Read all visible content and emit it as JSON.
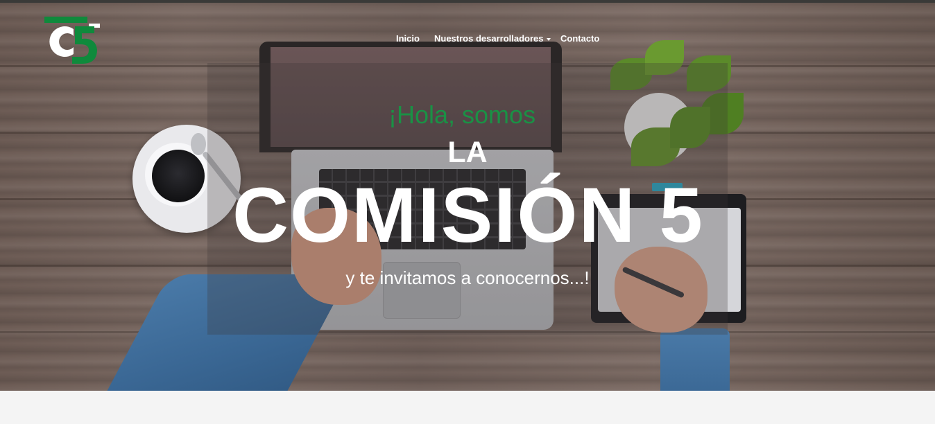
{
  "brand": {
    "logo_text": "C5",
    "primary_color": "#0f8a3c",
    "logo_white": "#ffffff"
  },
  "nav": {
    "items": [
      {
        "label": "Inicio"
      },
      {
        "label": "Nuestros desarrolladores",
        "has_dropdown": true
      },
      {
        "label": "Contacto"
      }
    ]
  },
  "hero": {
    "greeting": "¡Hola, somos",
    "article": "LA",
    "title": "COMISIÓN 5",
    "tagline": "y te invitamos a conocernos...!",
    "greeting_color": "#1a9145",
    "text_color": "#ffffff"
  }
}
